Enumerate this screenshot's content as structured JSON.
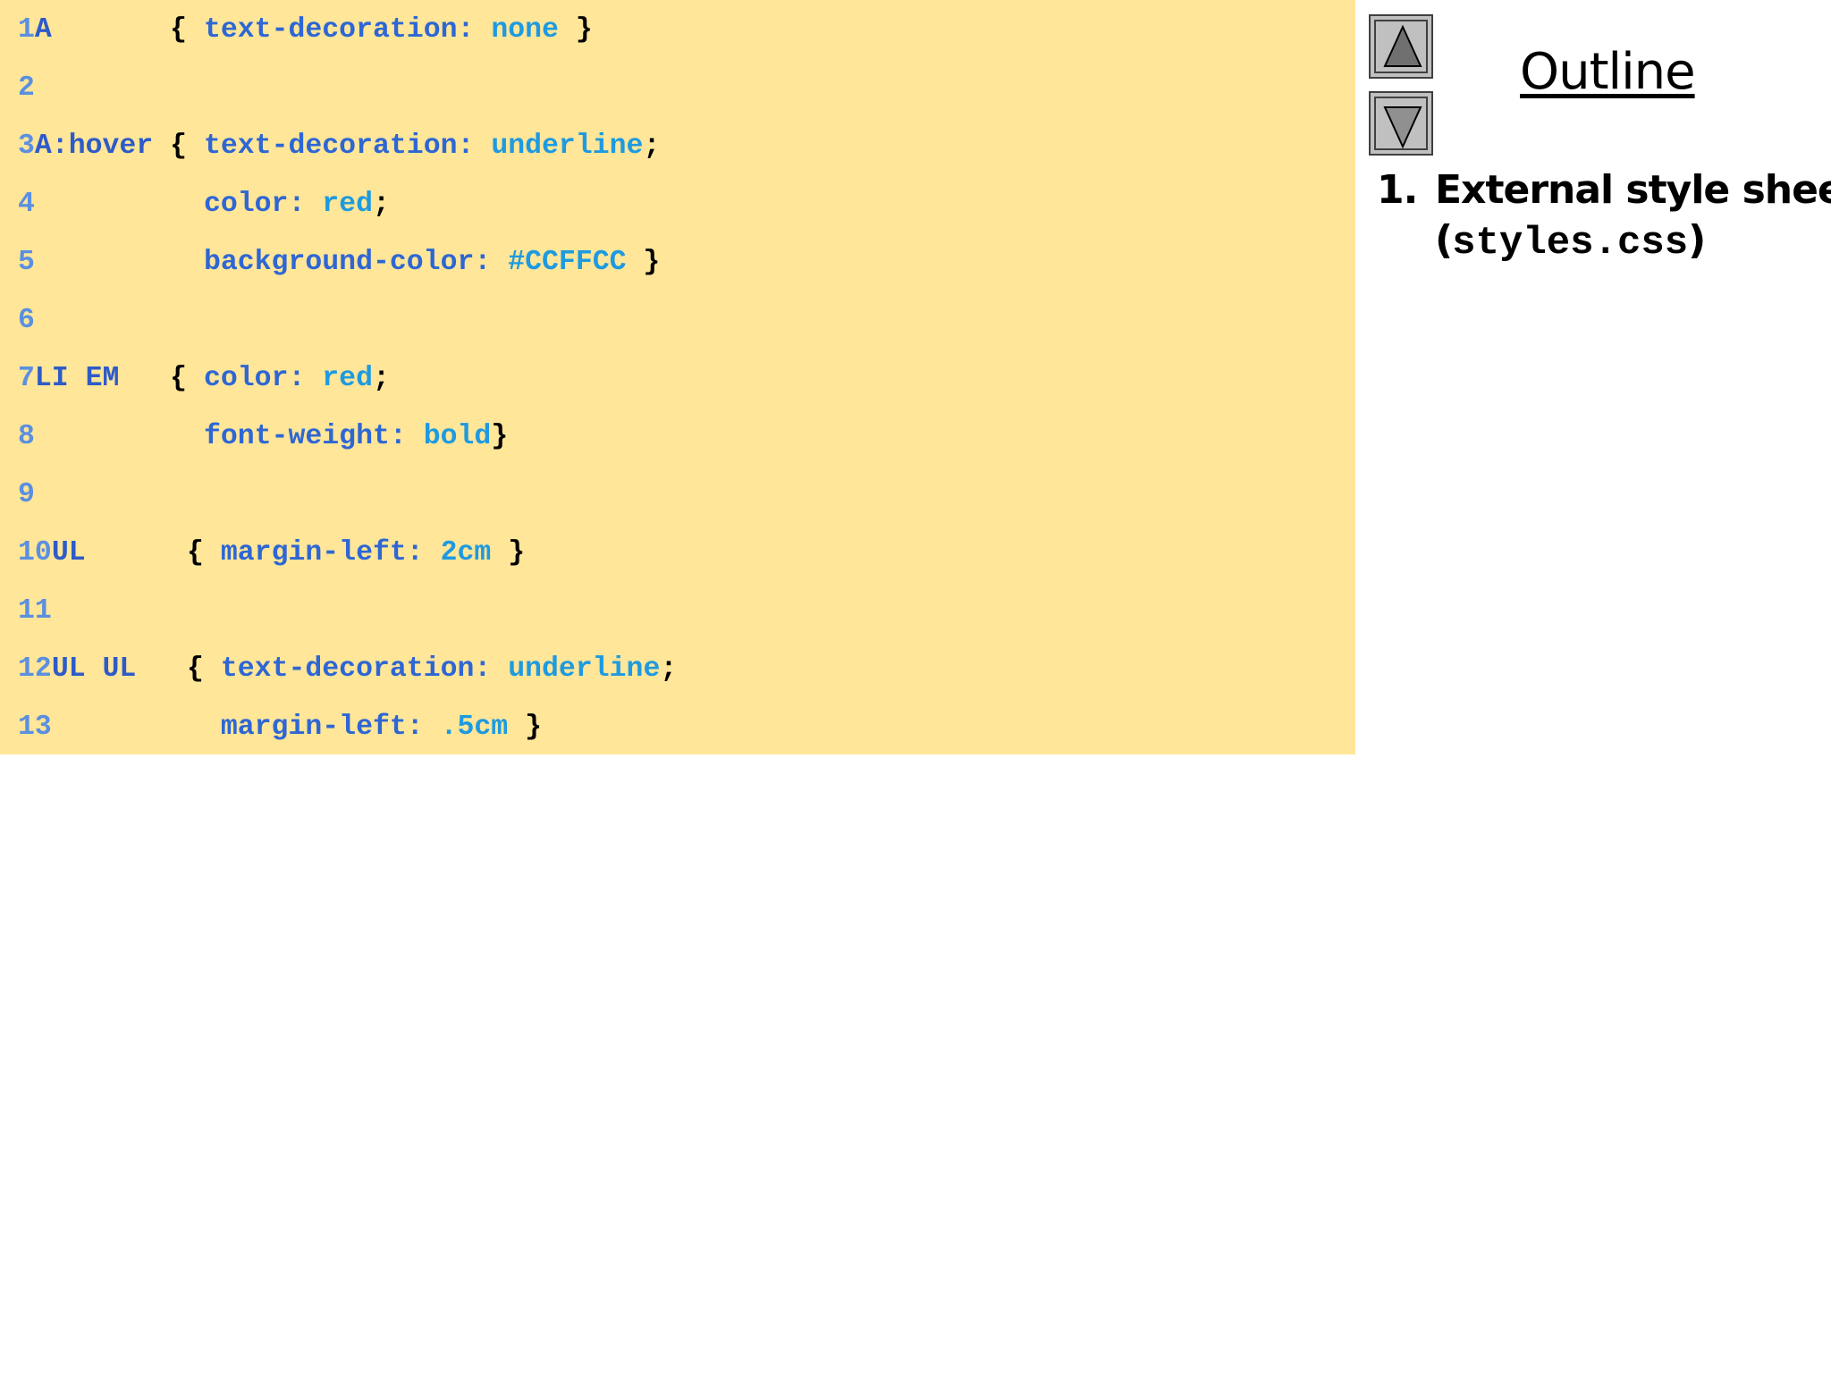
{
  "code": {
    "lines": [
      {
        "num": "1",
        "sel": "A",
        "pad1": "       ",
        "open": "{ ",
        "indent": "",
        "prop": "text-decoration: ",
        "val": "none",
        "tail": " }"
      },
      {
        "num": "2",
        "sel": "",
        "pad1": "",
        "open": "",
        "indent": "",
        "prop": "",
        "val": "",
        "tail": ""
      },
      {
        "num": "3",
        "sel": "A:hover",
        "pad1": " ",
        "open": "{ ",
        "indent": "",
        "prop": "text-decoration: ",
        "val": "underline",
        "tail": ";"
      },
      {
        "num": "4",
        "sel": "",
        "pad1": "          ",
        "open": "",
        "indent": "",
        "prop": "color: ",
        "val": "red",
        "tail": ";"
      },
      {
        "num": "5",
        "sel": "",
        "pad1": "          ",
        "open": "",
        "indent": "",
        "prop": "background-color: ",
        "val": "#CCFFCC",
        "tail": " }"
      },
      {
        "num": "6",
        "sel": "",
        "pad1": "",
        "open": "",
        "indent": "",
        "prop": "",
        "val": "",
        "tail": ""
      },
      {
        "num": "7",
        "sel": "LI EM",
        "pad1": "   ",
        "open": "{ ",
        "indent": "",
        "prop": "color: ",
        "val": "red",
        "tail": ";"
      },
      {
        "num": "8",
        "sel": "",
        "pad1": "          ",
        "open": "",
        "indent": "",
        "prop": "font-weight: ",
        "val": "bold",
        "tail": "}"
      },
      {
        "num": "9",
        "sel": "",
        "pad1": "",
        "open": "",
        "indent": "",
        "prop": "",
        "val": "",
        "tail": ""
      },
      {
        "num": "10",
        "sel": "UL",
        "pad1": "      ",
        "open": "{ ",
        "indent": "",
        "prop": "margin-left: ",
        "val": "2cm",
        "tail": " }"
      },
      {
        "num": "11",
        "sel": "",
        "pad1": "",
        "open": "",
        "indent": "",
        "prop": "",
        "val": "",
        "tail": ""
      },
      {
        "num": "12",
        "sel": "UL UL",
        "pad1": "   ",
        "open": "{ ",
        "indent": "",
        "prop": "text-decoration: ",
        "val": "underline",
        "tail": ";"
      },
      {
        "num": "13",
        "sel": "",
        "pad1": "          ",
        "open": "",
        "indent": "",
        "prop": "margin-left: ",
        "val": ".5cm",
        "tail": " }"
      }
    ]
  },
  "outline": {
    "title": "Outline",
    "item_number": "1.",
    "item_line1": "External style sheet",
    "item_paren_open": "(",
    "item_filename": "styles.css",
    "item_paren_close": ")"
  },
  "nav": {
    "up_icon": "triangle-up-icon",
    "down_icon": "triangle-down-icon"
  },
  "colors": {
    "code_background": "#FFE699",
    "line_number": "#5B8FE0",
    "selector": "#2E5BC8",
    "property": "#2E66D4",
    "value": "#1E9AE0",
    "punctuation": "#000000"
  }
}
